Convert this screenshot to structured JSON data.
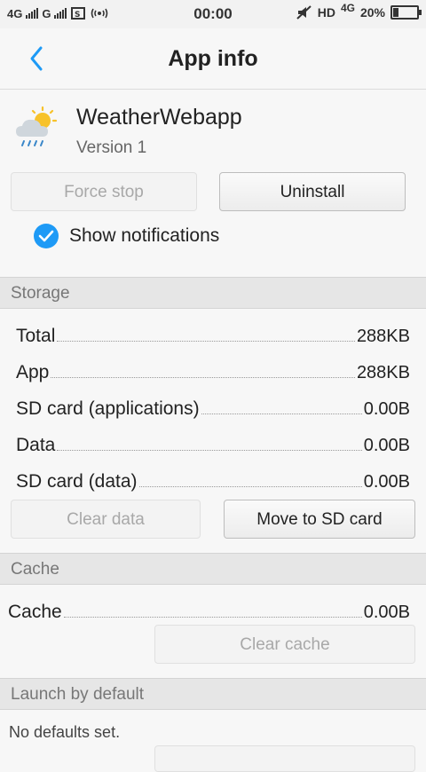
{
  "status_bar": {
    "left_text_1": "4G",
    "left_text_2": "G",
    "time": "00:00",
    "hd": "HD",
    "network": "4G",
    "battery": "20%",
    "battery_level": 0.2
  },
  "header": {
    "title": "App info"
  },
  "app": {
    "name": "WeatherWebapp",
    "version": "Version 1"
  },
  "buttons": {
    "force_stop": "Force stop",
    "uninstall": "Uninstall",
    "clear_data": "Clear data",
    "move_to_sd": "Move to SD card",
    "clear_cache": "Clear cache"
  },
  "show_notifications": {
    "label": "Show notifications",
    "checked": true
  },
  "storage": {
    "header": "Storage",
    "rows": [
      {
        "label": "Total",
        "value": "288KB"
      },
      {
        "label": "App",
        "value": "288KB"
      },
      {
        "label": "SD card (applications)",
        "value": "0.00B"
      },
      {
        "label": "Data",
        "value": "0.00B"
      },
      {
        "label": "SD card (data)",
        "value": "0.00B"
      }
    ]
  },
  "cache": {
    "header": "Cache",
    "label": "Cache",
    "value": "0.00B"
  },
  "launch": {
    "header": "Launch by default",
    "text": "No defaults set."
  },
  "colors": {
    "accent": "#1e9af6"
  }
}
